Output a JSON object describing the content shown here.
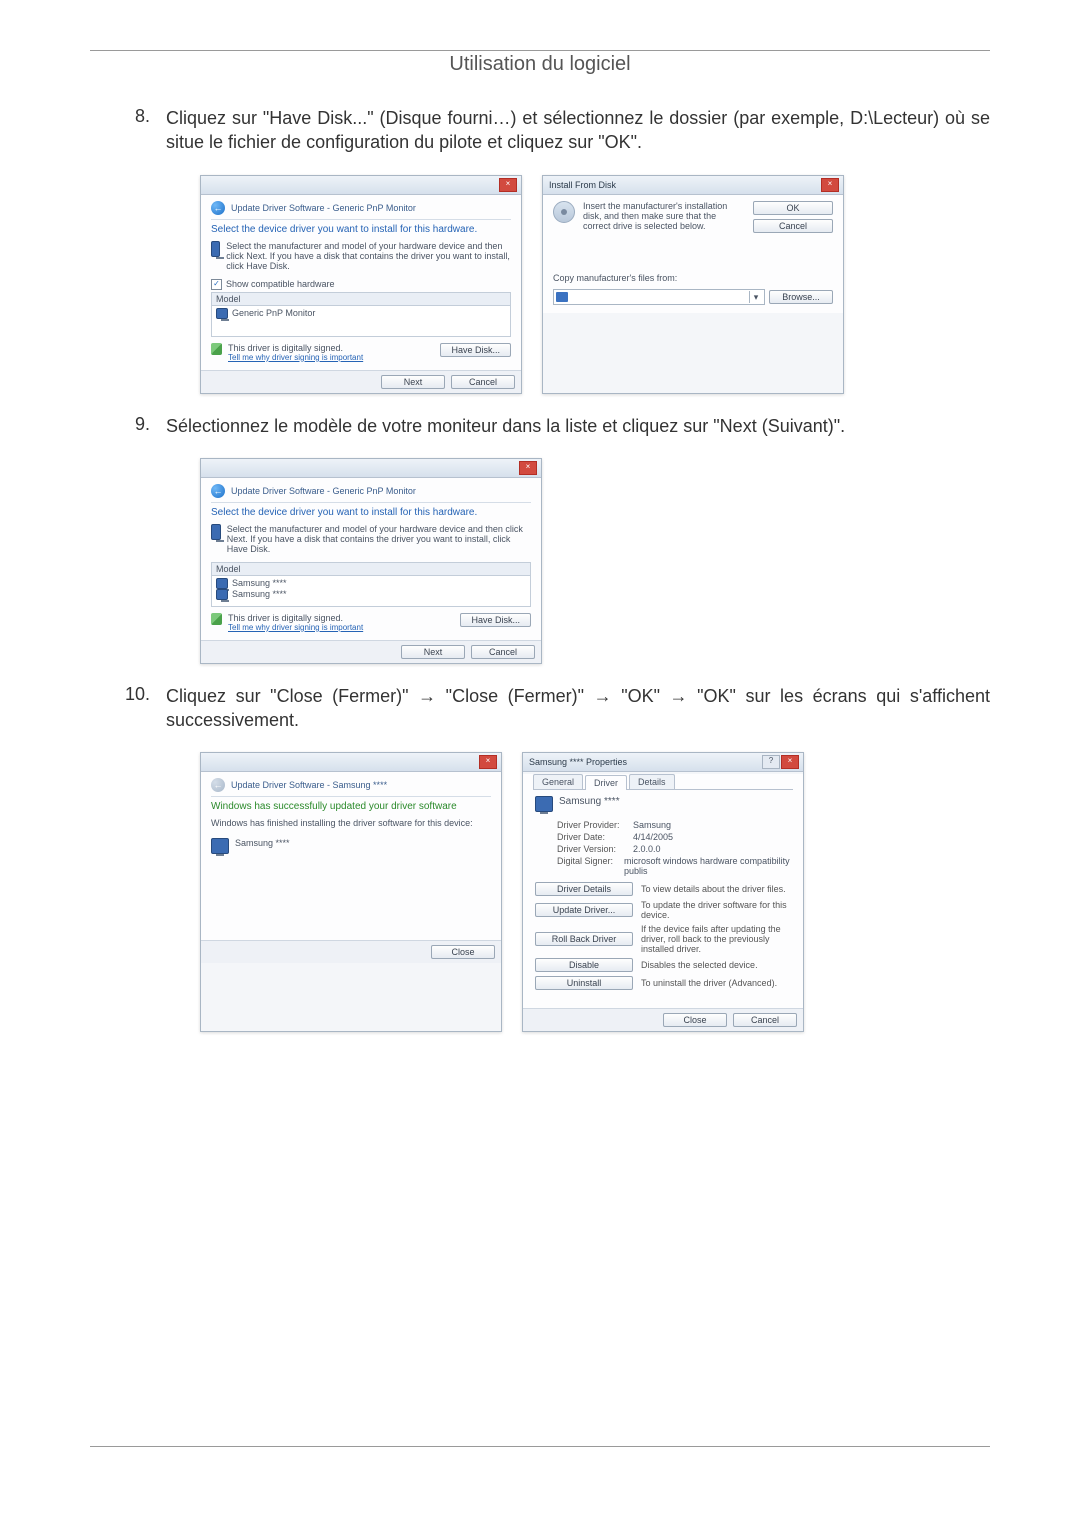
{
  "page_title": "Utilisation du logiciel",
  "steps": [
    {
      "num": "8.",
      "text": "Cliquez sur \"Have Disk...\" (Disque fourni…) et sélectionnez le dossier (par exemple, D:\\Lecteur) où se situe le fichier de configuration du pilote et cliquez sur \"OK\"."
    },
    {
      "num": "9.",
      "text": "Sélectionnez le modèle de votre moniteur dans la liste et cliquez sur \"Next (Suivant)\"."
    },
    {
      "num": "10.",
      "text": "Cliquez sur \"Close (Fermer)\" → \"Close (Fermer)\" → \"OK\" → \"OK\" sur les écrans qui s'affichent successivement."
    }
  ],
  "win_generic": {
    "nav": "Update Driver Software - Generic PnP Monitor",
    "heading": "Select the device driver you want to install for this hardware.",
    "hint": "Select the manufacturer and model of your hardware device and then click Next. If you have a disk that contains the driver you want to install, click Have Disk.",
    "show_compat": "Show compatible hardware",
    "model_hdr": "Model",
    "model_item": "Generic PnP Monitor",
    "signed": "This driver is digitally signed.",
    "linktext": "Tell me why driver signing is important",
    "have_disk": "Have Disk...",
    "next": "Next",
    "cancel": "Cancel"
  },
  "win_install": {
    "title": "Install From Disk",
    "msg": "Insert the manufacturer's installation disk, and then make sure that the correct drive is selected below.",
    "ok": "OK",
    "cancel": "Cancel",
    "copy_label": "Copy manufacturer's files from:",
    "browse": "Browse..."
  },
  "win_model": {
    "nav": "Update Driver Software - Generic PnP Monitor",
    "heading": "Select the device driver you want to install for this hardware.",
    "hint": "Select the manufacturer and model of your hardware device and then click Next. If you have a disk that contains the driver you want to install, click Have Disk.",
    "model_hdr": "Model",
    "items": [
      "Samsung ****",
      "Samsung ****"
    ],
    "signed": "This driver is digitally signed.",
    "linktext": "Tell me why driver signing is important",
    "have_disk": "Have Disk...",
    "next": "Next",
    "cancel": "Cancel"
  },
  "win_done": {
    "nav": "Update Driver Software - Samsung ****",
    "heading": "Windows has successfully updated your driver software",
    "sub": "Windows has finished installing the driver software for this device:",
    "item": "Samsung ****",
    "close": "Close"
  },
  "win_props": {
    "title": "Samsung **** Properties",
    "tabs": [
      "General",
      "Driver",
      "Details"
    ],
    "device_name": "Samsung ****",
    "rows": [
      {
        "label": "Driver Provider:",
        "value": "Samsung"
      },
      {
        "label": "Driver Date:",
        "value": "4/14/2005"
      },
      {
        "label": "Driver Version:",
        "value": "2.0.0.0"
      },
      {
        "label": "Digital Signer:",
        "value": "microsoft windows hardware compatibility publis"
      }
    ],
    "buttons": [
      {
        "label": "Driver Details",
        "desc": "To view details about the driver files."
      },
      {
        "label": "Update Driver...",
        "desc": "To update the driver software for this device."
      },
      {
        "label": "Roll Back Driver",
        "desc": "If the device fails after updating the driver, roll back to the previously installed driver."
      },
      {
        "label": "Disable",
        "desc": "Disables the selected device."
      },
      {
        "label": "Uninstall",
        "desc": "To uninstall the driver (Advanced)."
      }
    ],
    "close": "Close",
    "cancel": "Cancel"
  }
}
